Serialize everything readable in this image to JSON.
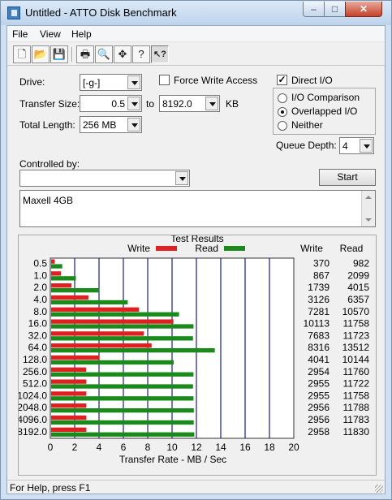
{
  "window": {
    "title": "Untitled - ATTO Disk Benchmark",
    "controls": {
      "minimize": "–",
      "maximize": "□",
      "close": "✕"
    }
  },
  "menu": [
    "File",
    "View",
    "Help"
  ],
  "toolbar": {
    "buttons": [
      {
        "name": "new-icon",
        "glyph": "🗋"
      },
      {
        "name": "open-icon",
        "glyph": "📂"
      },
      {
        "name": "save-icon",
        "glyph": "💾"
      },
      {
        "name": "print-icon",
        "glyph": "🖶"
      },
      {
        "name": "print-preview-icon",
        "glyph": "🔍"
      },
      {
        "name": "move-icon",
        "glyph": "✥"
      },
      {
        "name": "about-icon",
        "glyph": "?"
      },
      {
        "name": "context-help-icon",
        "glyph": "↖?"
      }
    ]
  },
  "form": {
    "drive_label": "Drive:",
    "drive_value": "[-g-]",
    "force_write_label": "Force Write Access",
    "force_write_checked": false,
    "transfer_size_label": "Transfer Size:",
    "transfer_from": "0.5",
    "transfer_to_label": "to",
    "transfer_to": "8192.0",
    "transfer_unit": "KB",
    "total_length_label": "Total Length:",
    "total_length_value": "256 MB",
    "direct_io_label": "Direct I/O",
    "direct_io_checked": true,
    "io_options": [
      {
        "label": "I/O Comparison",
        "selected": false
      },
      {
        "label": "Overlapped I/O",
        "selected": true
      },
      {
        "label": "Neither",
        "selected": false
      }
    ],
    "queue_depth_label": "Queue Depth:",
    "queue_depth_value": "4",
    "controlled_by_label": "Controlled by:",
    "controlled_by_value": "",
    "start_label": "Start",
    "description": "Maxell 4GB"
  },
  "status": "For Help, press F1",
  "colors": {
    "write": "#e02020",
    "read": "#1a8a1a",
    "grid": "#1a1a8c"
  },
  "chart_data": {
    "type": "bar",
    "title": "Test Results",
    "xlabel": "Transfer Rate - MB / Sec",
    "ylabel": "",
    "xlim": [
      0,
      20
    ],
    "xticks": [
      0,
      2,
      4,
      6,
      8,
      10,
      12,
      14,
      16,
      18,
      20
    ],
    "legend": "top",
    "column_headers": [
      "Write",
      "Read"
    ],
    "categories": [
      "0.5",
      "1.0",
      "2.0",
      "4.0",
      "8.0",
      "16.0",
      "32.0",
      "64.0",
      "128.0",
      "256.0",
      "512.0",
      "1024.0",
      "2048.0",
      "4096.0",
      "8192.0"
    ],
    "series": [
      {
        "name": "Write",
        "values": [
          0.37,
          0.87,
          1.74,
          3.13,
          7.28,
          10.11,
          7.68,
          8.32,
          4.04,
          2.95,
          2.96,
          2.96,
          2.96,
          2.96,
          2.96
        ],
        "table": [
          "370",
          "867",
          "1739",
          "3126",
          "7281",
          "10113",
          "7683",
          "8316",
          "4041",
          "2954",
          "2955",
          "2955",
          "2956",
          "2956",
          "2958"
        ]
      },
      {
        "name": "Read",
        "values": [
          0.98,
          2.1,
          4.02,
          6.36,
          10.57,
          11.76,
          11.72,
          13.51,
          10.14,
          11.76,
          11.72,
          11.76,
          11.79,
          11.78,
          11.83
        ],
        "table": [
          "982",
          "2099",
          "4015",
          "6357",
          "10570",
          "11758",
          "11723",
          "13512",
          "10144",
          "11760",
          "11722",
          "11758",
          "11788",
          "11783",
          "11830"
        ]
      }
    ]
  }
}
